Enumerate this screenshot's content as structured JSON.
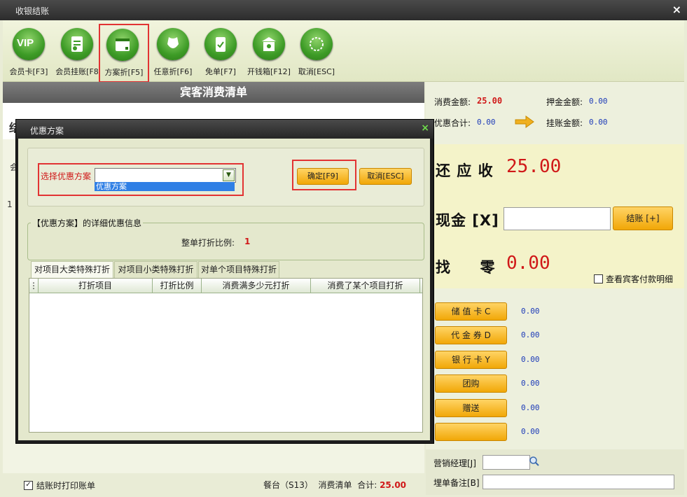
{
  "window": {
    "title": "收银结账",
    "close_glyph": "×"
  },
  "toolbar": {
    "buttons": [
      {
        "label": "会员卡[F3]",
        "icon": "vip-icon"
      },
      {
        "label": "会员挂账[F8",
        "icon": "member-account-icon"
      },
      {
        "label": "方案折[F5]",
        "icon": "scheme-discount-icon"
      },
      {
        "label": "任意折[F6]",
        "icon": "any-discount-icon"
      },
      {
        "label": "免单[F7]",
        "icon": "free-order-icon"
      },
      {
        "label": "开钱箱[F12]",
        "icon": "cash-box-icon"
      },
      {
        "label": "取消[ESC]",
        "icon": "cancel-icon"
      }
    ],
    "selected_index": 2
  },
  "bill": {
    "title": "宾客消费清单",
    "partial_labels": [
      "结",
      "会",
      "1"
    ]
  },
  "footer": {
    "print_label": "结账时打印账单",
    "print_checked": true,
    "table_label": "餐台（S13）",
    "list_label": "消费清单",
    "total_label": "合计:",
    "total_value": "25.00"
  },
  "summary": {
    "consume_label": "消费金额:",
    "consume_value": "25.00",
    "deposit_label": "押金金额:",
    "deposit_value": "0.00",
    "discount_label": "优惠合计:",
    "discount_value": "0.00",
    "charge_label": "挂账金额:",
    "charge_value": "0.00"
  },
  "due": {
    "label": "还 应 收",
    "value": "25.00",
    "cash_label": "现金 [X]",
    "cash_value": "",
    "settle_button": "结账 [+]",
    "change_label": "找     零",
    "change_value": "0.00",
    "guest_detail_label": "查看宾客付款明细"
  },
  "payments": [
    {
      "label": "储 值 卡 C",
      "value": "0.00"
    },
    {
      "label": "代 金 券 D",
      "value": "0.00"
    },
    {
      "label": "银 行 卡 Y",
      "value": "0.00"
    },
    {
      "label": "团购",
      "value": "0.00"
    },
    {
      "label": "赠送",
      "value": "0.00"
    },
    {
      "label": "",
      "value": "0.00"
    }
  ],
  "bottom": {
    "manager_label": "营销经理[J]",
    "manager_value": "",
    "remark_label": "埋单备注[B]",
    "remark_value": ""
  },
  "dialog": {
    "title": "优惠方案",
    "close_glyph": "×",
    "select_label": "选择优惠方案",
    "combo_value": "",
    "dropdown_item": "优惠方案",
    "confirm_button": "确定[F9]",
    "cancel_button": "取消[ESC]",
    "group_title": "【优惠方案】的详细优惠信息",
    "ratio_label": "整单打折比例:",
    "ratio_value": "1",
    "tabs": [
      "对项目大类特殊打折",
      "对项目小类特殊打折",
      "对单个项目特殊打折"
    ],
    "active_tab": 0,
    "grid_columns": [
      "打折项目",
      "打折比例",
      "消费满多少元打折",
      "消费了某个项目打折"
    ]
  },
  "colors": {
    "accent_red": "#d01818",
    "value_blue": "#1c3ab8",
    "button_orange": "#f1a707",
    "highlight_box": "#e23333"
  }
}
